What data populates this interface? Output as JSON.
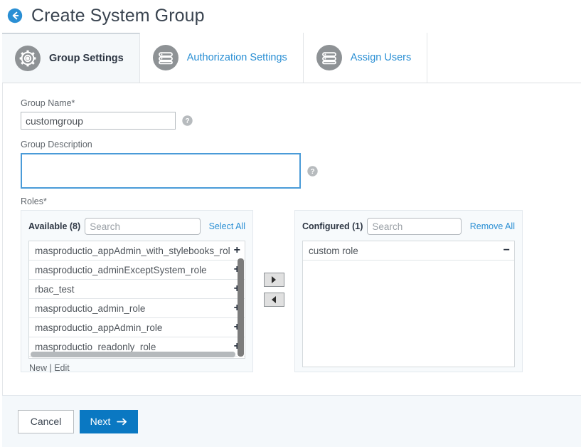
{
  "header": {
    "title": "Create System Group",
    "back_icon": "back-arrow-circle-icon"
  },
  "tabs": [
    {
      "label": "Group Settings",
      "icon": "gear-icon",
      "active": true
    },
    {
      "label": "Authorization Settings",
      "icon": "server-stack-icon",
      "active": false
    },
    {
      "label": "Assign Users",
      "icon": "server-stack-icon",
      "active": false
    }
  ],
  "form": {
    "group_name": {
      "label": "Group Name*",
      "value": "customgroup",
      "placeholder": "",
      "help_icon": "help-circle-icon"
    },
    "group_description": {
      "label": "Group Description",
      "value": "",
      "placeholder": "",
      "help_icon": "help-circle-icon"
    },
    "roles": {
      "label": "Roles*",
      "available": {
        "heading": "Available (8)",
        "search_placeholder": "Search",
        "search_value": "",
        "action_label": "Select All",
        "items": [
          "masproductio_appAdmin_with_stylebooks_role",
          "masproductio_adminExceptSystem_role",
          "rbac_test",
          "masproductio_admin_role",
          "masproductio_appAdmin_role",
          "masproductio_readonly_role"
        ],
        "item_action_glyph": "+",
        "footer_new": "New",
        "footer_sep": " | ",
        "footer_edit": "Edit"
      },
      "configured": {
        "heading": "Configured (1)",
        "search_placeholder": "Search",
        "search_value": "",
        "action_label": "Remove All",
        "items": [
          "custom role"
        ],
        "item_action_glyph": "−"
      },
      "transfer": {
        "move_right_icon": "triangle-right-icon",
        "move_left_icon": "triangle-left-icon"
      }
    }
  },
  "footer": {
    "cancel_label": "Cancel",
    "next_label": "Next",
    "next_icon": "arrow-right-icon"
  },
  "colors": {
    "accent_blue": "#0a78c2",
    "link_blue": "#2a8fd4",
    "focus_border": "#4a9bd8",
    "panel_bg": "#f7fafc",
    "footer_bg": "#f4f8fb",
    "text_dark": "#3a4450",
    "icon_gray": "#8e9295"
  }
}
